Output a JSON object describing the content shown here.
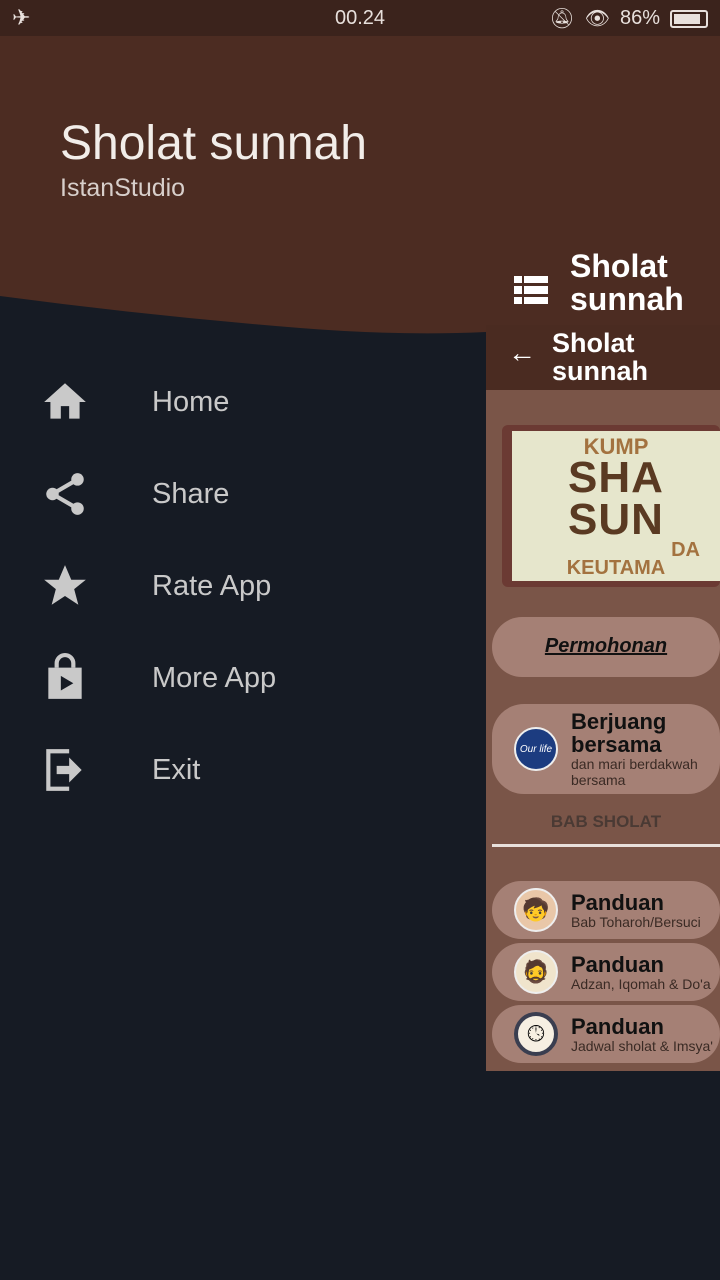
{
  "status": {
    "time": "00.24",
    "battery": "86%",
    "battery_level": 0.86,
    "icons": [
      "airplane-icon",
      "bell-off-icon",
      "eye-icon",
      "battery-icon"
    ]
  },
  "drawer": {
    "title": "Sholat sunnah",
    "subtitle": "IstanStudio",
    "items": [
      {
        "label": "Home",
        "icon": "home-icon"
      },
      {
        "label": "Share",
        "icon": "share-icon"
      },
      {
        "label": "Rate App",
        "icon": "star-icon"
      },
      {
        "label": "More App",
        "icon": "play-store-icon"
      },
      {
        "label": "Exit",
        "icon": "exit-icon"
      }
    ]
  },
  "main": {
    "appbar_title": "Sholat sunnah",
    "toolbar_title": "Sholat sunnah",
    "banner": {
      "line1": "KUMP",
      "line2": "SHA",
      "line3": "SUN",
      "line4": "DA",
      "line5": "KEUTAMA"
    },
    "request_link": "Permohonan",
    "promo": {
      "title": "Berjuang bersama",
      "subtitle": "dan mari berdakwah bersama"
    },
    "section": "BAB SHOLAT",
    "list": [
      {
        "title": "Panduan",
        "subtitle": "Bab Toharoh/Bersuci"
      },
      {
        "title": "Panduan",
        "subtitle": "Adzan, Iqomah & Do'a"
      },
      {
        "title": "Panduan",
        "subtitle": "Jadwal sholat & Imsya'"
      }
    ]
  },
  "colors": {
    "header": "#4c2c22",
    "drawer": "#161b24",
    "content": "#7a5548",
    "card": "#a58075"
  }
}
